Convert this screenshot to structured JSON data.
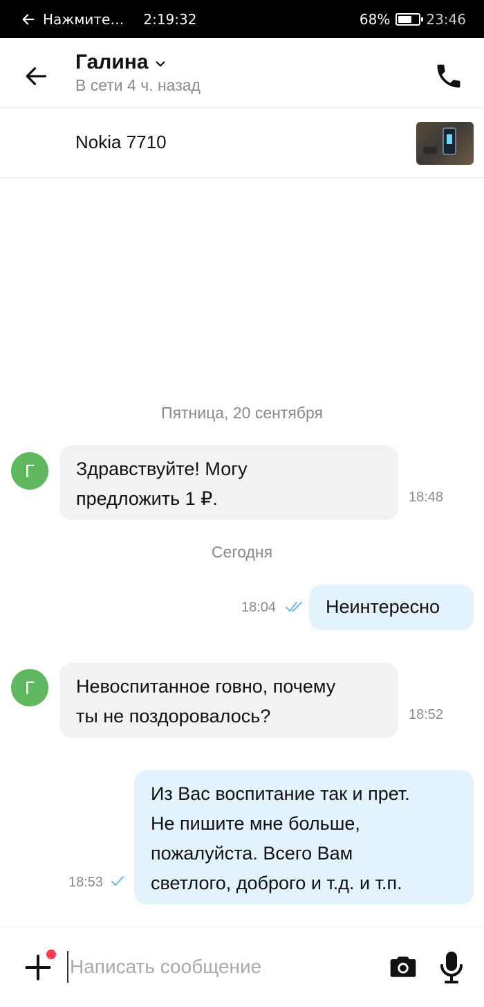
{
  "status_bar": {
    "notification": "Нажмите…",
    "timer": "2:19:32",
    "battery_percent": "68%",
    "battery_level": 0.68,
    "clock": "23:46"
  },
  "header": {
    "name": "Галина",
    "status": "В сети 4 ч. назад"
  },
  "item": {
    "title": "Nokia 7710"
  },
  "chat": {
    "date_1": "Пятница, 20 сентября",
    "date_2": "Сегодня",
    "messages": [
      {
        "dir": "in",
        "avatar_letter": "Г",
        "line1": "Здравствуйте! Могу",
        "line2": "предложить 1 ₽.",
        "time": "18:48"
      },
      {
        "dir": "out",
        "line1": "Неинтересно",
        "time": "18:04",
        "status": "read"
      },
      {
        "dir": "in",
        "avatar_letter": "Г",
        "line1": "Невоспитанное говно, почему",
        "line2": "ты не поздоровалось?",
        "time": "18:52"
      },
      {
        "dir": "out",
        "line1": "Из Вас воспитание так и прет.",
        "line2": "Не пишите мне больше,",
        "line3": "пожалуйста. Всего Вам",
        "line4": "светлого, доброго и т.д. и т.п.",
        "time": "18:53",
        "status": "sent"
      }
    ]
  },
  "input": {
    "placeholder": "Написать сообщение",
    "value": ""
  },
  "colors": {
    "incoming_bubble": "#f2f2f2",
    "outgoing_bubble": "#e3f3fd",
    "avatar": "#5fb85f",
    "badge": "#ff3b4e",
    "tick": "#6ab7e8"
  },
  "icons": [
    "back-arrow-icon",
    "chevron-down-icon",
    "phone-icon",
    "plus-icon",
    "camera-icon",
    "microphone-icon",
    "double-check-icon",
    "check-icon",
    "battery-icon"
  ]
}
